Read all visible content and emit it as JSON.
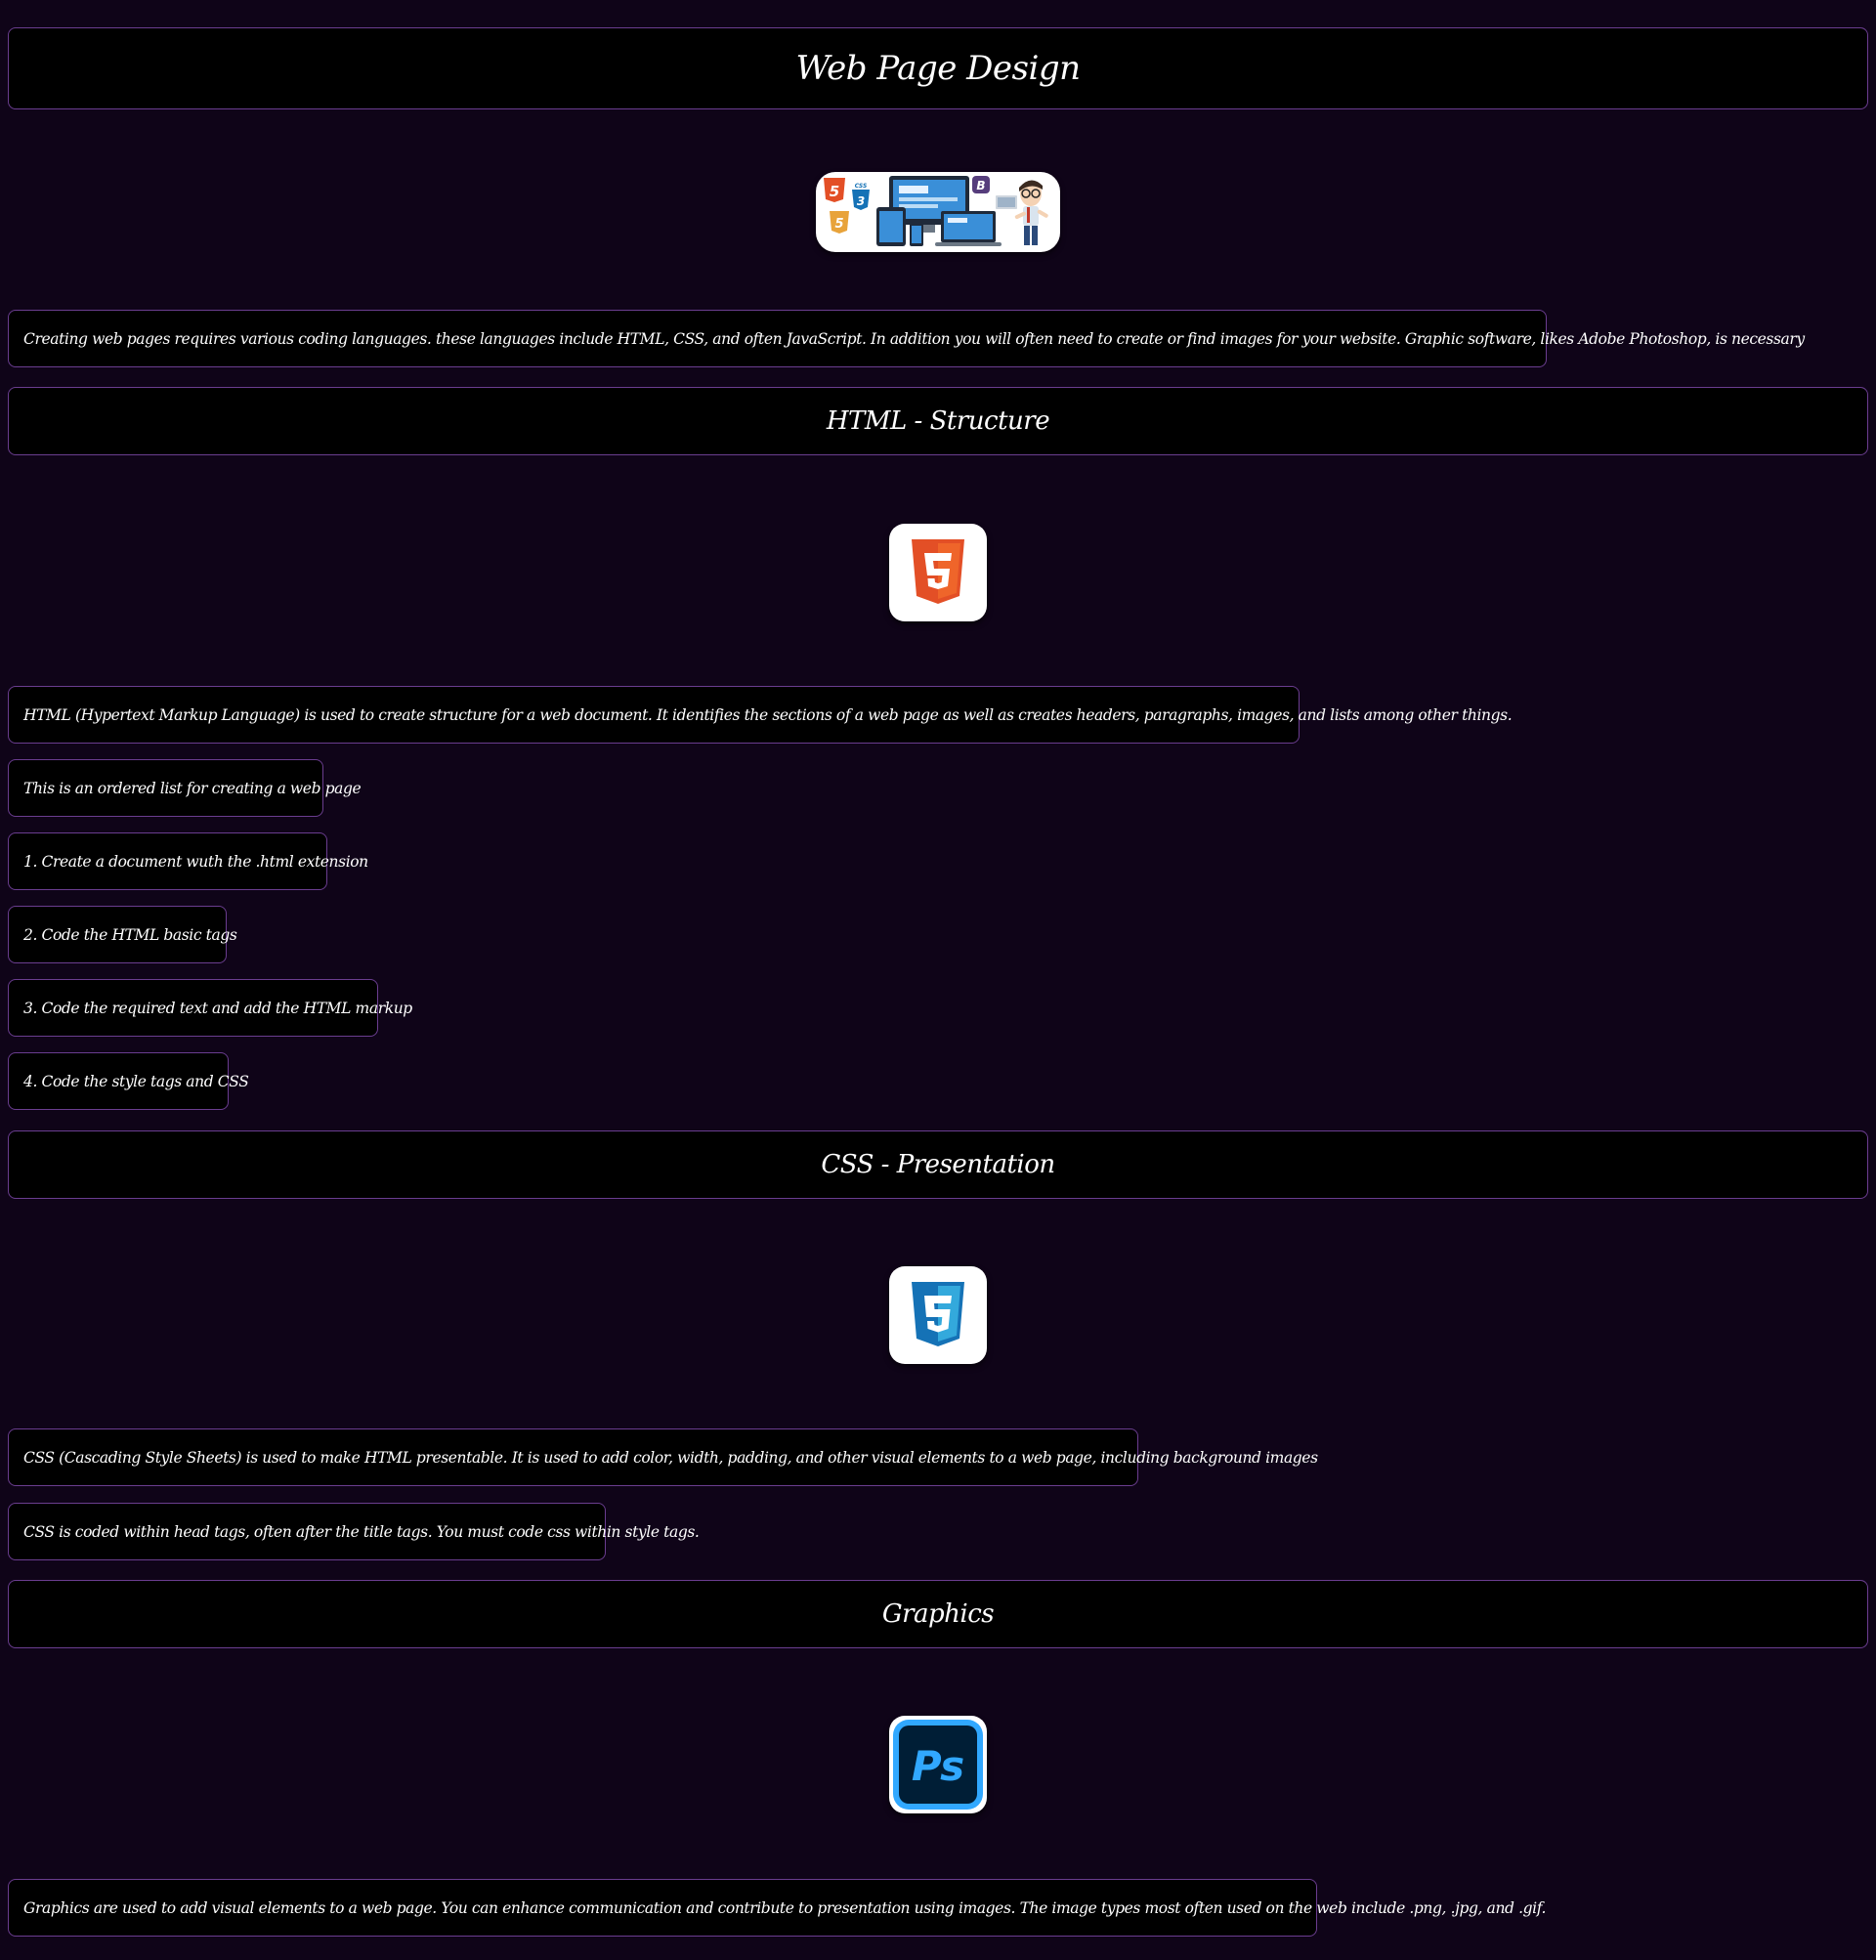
{
  "page_title": "Web Page Design",
  "intro": "Creating web pages requires various coding languages. these languages include HTML, CSS, and often JavaScript. In addition you will often need to create or find images for your website. Graphic software, likes Adobe Photoshop, is necessary",
  "html_section": {
    "heading": "HTML - Structure",
    "description": "HTML (Hypertext Markup Language) is used to create structure for a web document. It identifies the sections of a web page as well as creates headers, paragraphs, images, and lists among other things.",
    "list_intro": "This is an ordered list for creating a web page",
    "steps": [
      "1. Create a document wuth the .html extension",
      "2. Code the HTML basic tags",
      "3. Code the required text and add the HTML markup",
      "4. Code the style tags and CSS"
    ]
  },
  "css_section": {
    "heading": "CSS - Presentation",
    "description": "CSS (Cascading Style Sheets) is used to make HTML presentable. It is used to add color, width, padding, and other visual elements to a web page, including background images",
    "note": "CSS is coded within head tags, often after the title tags. You must code css within style tags."
  },
  "graphics_section": {
    "heading": "Graphics",
    "description": "Graphics are used to add visual elements to a web page. You can enhance communication and contribute to presentation using images. The image types most often used on the web include .png, .jpg, and .gif.",
    "ps_label": "Ps"
  },
  "banner_icons": {
    "html5_digit": "5",
    "css3_digit": "3",
    "bootstrap_letter": "B",
    "css_label": "CSS"
  },
  "colors": {
    "background": "#0f0418",
    "box_background": "#000000",
    "box_border": "#6a3d8f",
    "html_orange": "#e34f26",
    "css_blue": "#1572b6",
    "ps_cyan": "#31a8ff",
    "ps_dark": "#001e36"
  }
}
